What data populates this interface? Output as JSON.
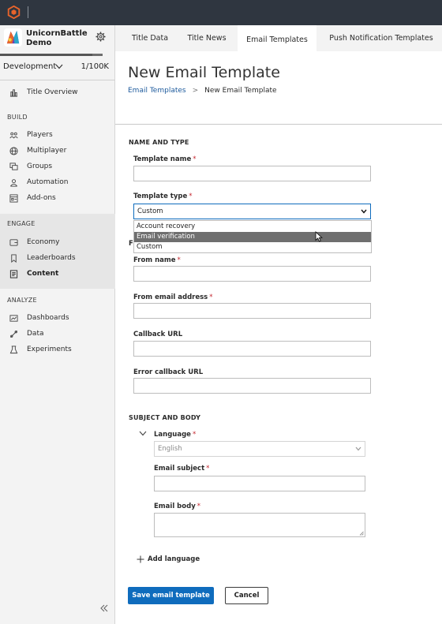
{
  "colors": {
    "topbar": "#2f3640",
    "accent": "#0f6cbd",
    "logo": "#e8642b",
    "required": "#c4262e",
    "hover_option": "#6f6f6f"
  },
  "topbar": {
    "logo_icon": "playfab-hex-logo-icon"
  },
  "sidebar": {
    "title_name": "UnicornBattle Demo",
    "environment": "Development",
    "player_count": "1/100K",
    "usage_fraction": 0.9,
    "overview": {
      "label": "Title Overview",
      "icon": "chart-bar-icon"
    },
    "build": {
      "heading": "BUILD",
      "items": [
        {
          "label": "Players",
          "icon": "players-icon"
        },
        {
          "label": "Multiplayer",
          "icon": "globe-icon"
        },
        {
          "label": "Groups",
          "icon": "groups-icon"
        },
        {
          "label": "Automation",
          "icon": "automation-icon"
        },
        {
          "label": "Add-ons",
          "icon": "add-ons-icon"
        }
      ]
    },
    "engage": {
      "heading": "ENGAGE",
      "items": [
        {
          "label": "Economy",
          "icon": "economy-icon"
        },
        {
          "label": "Leaderboards",
          "icon": "leaderboards-icon"
        },
        {
          "label": "Content",
          "icon": "content-icon",
          "active": true
        }
      ]
    },
    "analyze": {
      "heading": "ANALYZE",
      "items": [
        {
          "label": "Dashboards",
          "icon": "dashboards-icon"
        },
        {
          "label": "Data",
          "icon": "data-icon"
        },
        {
          "label": "Experiments",
          "icon": "experiments-icon"
        }
      ]
    },
    "collapse_glyph": "«"
  },
  "tabs": [
    {
      "label": "Title Data"
    },
    {
      "label": "Title News"
    },
    {
      "label": "Email Templates",
      "active": true
    },
    {
      "label": "Push Notification Templates"
    }
  ],
  "main": {
    "title": "New Email Template",
    "breadcrumb": {
      "parent": "Email Templates",
      "separator": ">",
      "current": "New Email Template"
    },
    "name_and_type": {
      "heading": "NAME AND TYPE",
      "template_name_label": "Template name",
      "template_name_value": "",
      "template_type_label": "Template type",
      "template_type_value": "Custom",
      "template_type_options": [
        "Account recovery",
        "Email verification",
        "Custom"
      ],
      "hovered_option": "Email verification",
      "required_mark": "*"
    },
    "from": {
      "heading_partial": "F",
      "from_name_label": "From name",
      "from_email_label": "From email address",
      "callback_url_label": "Callback URL",
      "error_callback_url_label": "Error callback URL"
    },
    "subject_and_body": {
      "heading": "SUBJECT AND BODY",
      "language_label": "Language",
      "language_value": "English",
      "email_subject_label": "Email subject",
      "email_body_label": "Email body",
      "add_language_label": "Add language"
    },
    "buttons": {
      "save_label": "Save email template",
      "cancel_label": "Cancel"
    }
  }
}
